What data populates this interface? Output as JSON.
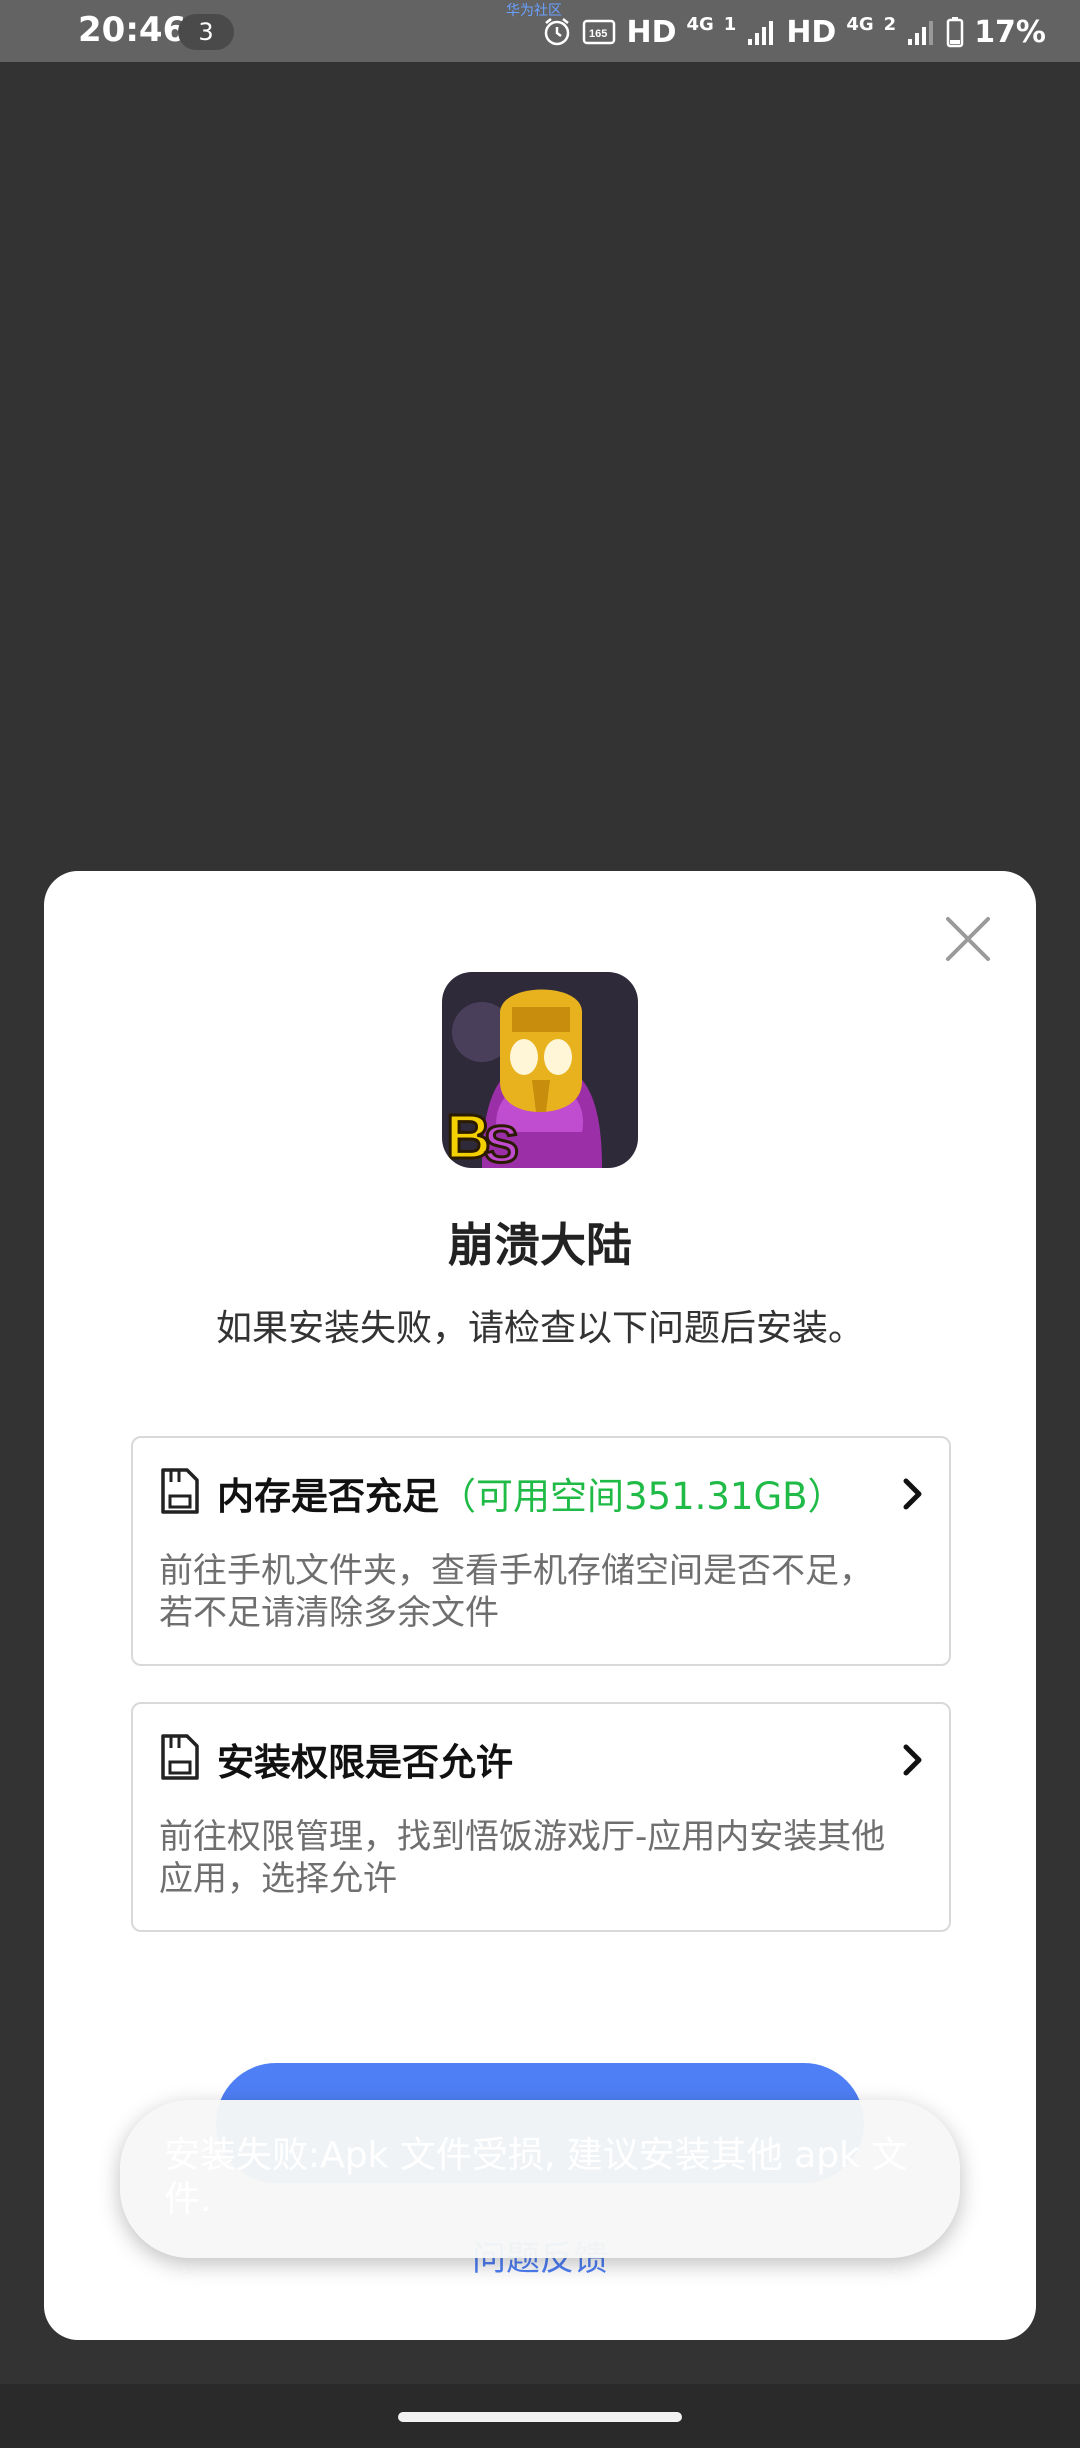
{
  "status_bar": {
    "time": "20:46",
    "notification_count": "3",
    "center_text": "华为社区",
    "hd1": "HD",
    "net1": "4G",
    "sim1": "1",
    "hd2": "HD",
    "net2": "4G",
    "sim2": "2",
    "battery": "17%"
  },
  "dialog": {
    "app_name": "崩溃大陆",
    "subtitle": "如果安装失败，请检查以下问题后安装。",
    "cards": [
      {
        "title": "内存是否充足",
        "highlight": "（可用空间351.31GB）",
        "description": "前往手机文件夹，查看手机存储空间是否不足，若不足请清除多余文件"
      },
      {
        "title": "安装权限是否允许",
        "description": "前往权限管理，找到悟饭游戏厅-应用内安装其他应用，选择允许"
      }
    ],
    "feedback": "问题反馈"
  },
  "toast": {
    "message": "安装失败:Apk 文件受损, 建议安装其他 apk 文件."
  },
  "colors": {
    "accent": "#4e7ff5",
    "highlight_green": "#1fbb46",
    "overlay": "#333333"
  }
}
